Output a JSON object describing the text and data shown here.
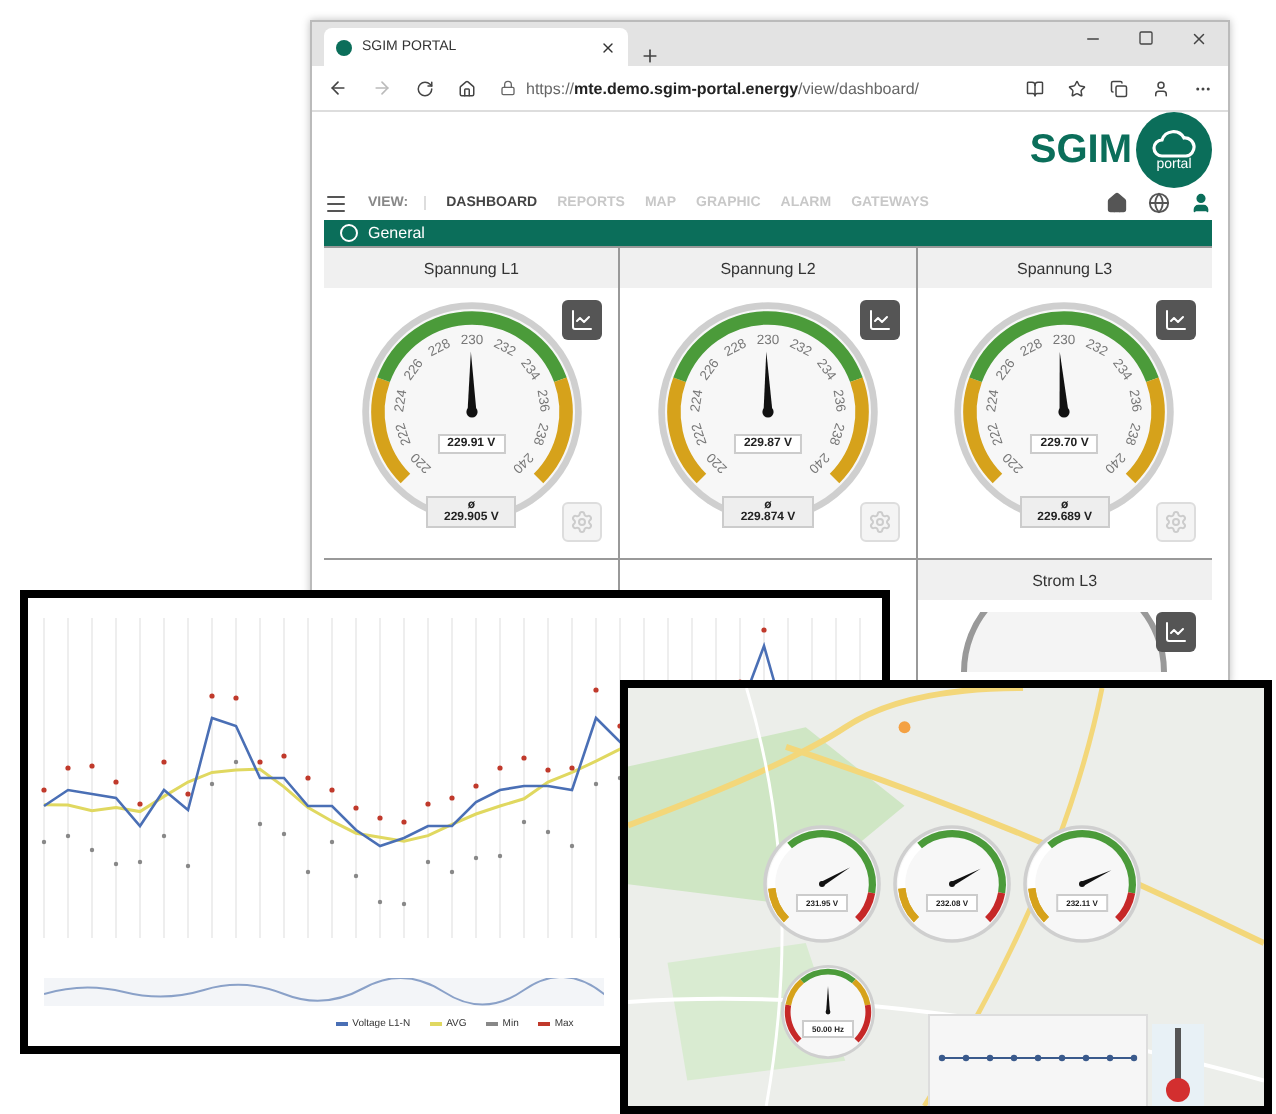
{
  "browser": {
    "tab_title": "SGIM PORTAL",
    "url": "https://**mte.demo.sgim-portal.energy**/view/dashboard/"
  },
  "logo": {
    "text": "SGIM",
    "badge": "portal"
  },
  "nav": {
    "view_label": "VIEW:",
    "items": [
      {
        "label": "DASHBOARD",
        "selected": true
      },
      {
        "label": "REPORTS",
        "selected": false
      },
      {
        "label": "MAP",
        "selected": false
      },
      {
        "label": "GRAPHIC",
        "selected": false
      },
      {
        "label": "ALARM",
        "selected": false
      },
      {
        "label": "GATEWAYS",
        "selected": false
      }
    ]
  },
  "section": {
    "title": "General"
  },
  "gauges": [
    {
      "title": "Spannung L1",
      "reading": "229.91 V",
      "avg_symbol": "ø",
      "average": "229.905 V",
      "level": 0.496,
      "scale": [
        "220",
        "222",
        "224",
        "226",
        "228",
        "230",
        "232",
        "234",
        "236",
        "238",
        "240"
      ]
    },
    {
      "title": "Spannung L2",
      "reading": "229.87 V",
      "avg_symbol": "ø",
      "average": "229.874 V",
      "level": 0.494,
      "scale": [
        "220",
        "222",
        "224",
        "226",
        "228",
        "230",
        "232",
        "234",
        "236",
        "238",
        "240"
      ]
    },
    {
      "title": "Spannung L3",
      "reading": "229.70 V",
      "avg_symbol": "ø",
      "average": "229.689 V",
      "level": 0.485,
      "scale": [
        "220",
        "222",
        "224",
        "226",
        "228",
        "230",
        "232",
        "234",
        "236",
        "238",
        "240"
      ]
    }
  ],
  "lower_cards": [
    {
      "title": "Strom L3"
    }
  ],
  "trend_chart": {
    "legend": [
      {
        "label": "Voltage L1-N",
        "color": "#4a6fb5"
      },
      {
        "label": "AVG",
        "color": "#e0d860"
      },
      {
        "label": "Min",
        "color": "#888888"
      },
      {
        "label": "Max",
        "color": "#c0392b"
      }
    ]
  },
  "map_view": {
    "gauges": [
      {
        "reading": "231.95 V",
        "level": 0.72
      },
      {
        "reading": "232.08 V",
        "level": 0.73
      },
      {
        "reading": "232.11 V",
        "level": 0.74
      },
      {
        "reading": "50.00 Hz",
        "level": 0.5
      }
    ]
  }
}
